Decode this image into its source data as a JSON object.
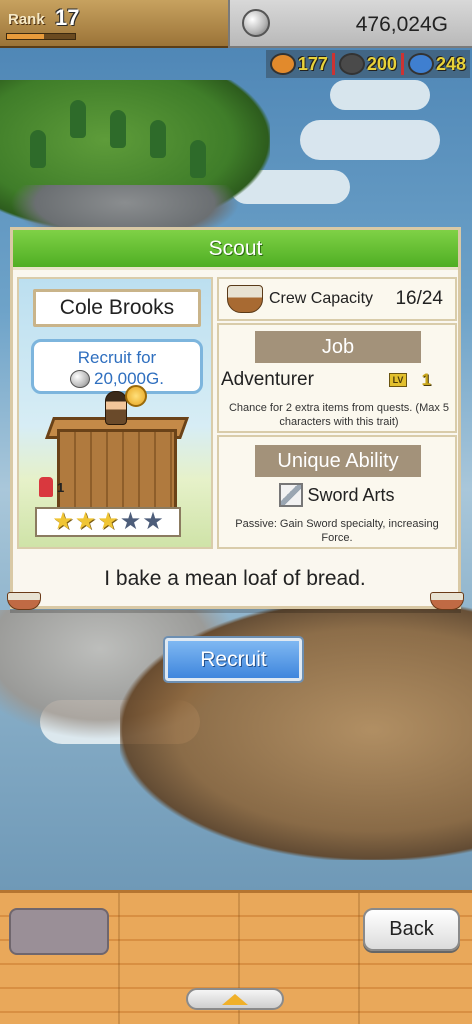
{
  "hud": {
    "rank_label": "Rank",
    "rank_value": "17",
    "rank_progress": 0.55,
    "gold_value": "476,024G",
    "resources": [
      {
        "icon": "food-icon",
        "value": "177",
        "color": "#e28a2c"
      },
      {
        "icon": "ore-icon",
        "value": "200",
        "color": "#4a4a4a"
      },
      {
        "icon": "gem-icon",
        "value": "248",
        "color": "#3f7fd0"
      }
    ]
  },
  "dialog": {
    "title": "Scout",
    "character": {
      "name": "Cole Brooks",
      "recruit_label": "Recruit for",
      "recruit_cost": "20,000G.",
      "rank_badge": "1",
      "stars_filled": 3,
      "stars_total": 5
    },
    "crew": {
      "label": "Crew Capacity",
      "value": "16/24"
    },
    "job": {
      "header": "Job",
      "name": "Adventurer",
      "level_badge": "LV",
      "level": "1",
      "description": "Chance for 2 extra items from quests. (Max 5 characters with this trait)"
    },
    "ability": {
      "header": "Unique Ability",
      "name": "Sword Arts",
      "description": "Passive: Gain Sword specialty, increasing Force."
    },
    "quote": "I bake a mean loaf of bread."
  },
  "actions": {
    "recruit_label": "Recruit",
    "back_label": "Back"
  },
  "colors": {
    "title_green": "#4fae23",
    "button_blue": "#3f86dd",
    "star_gold": "#f0c534"
  }
}
